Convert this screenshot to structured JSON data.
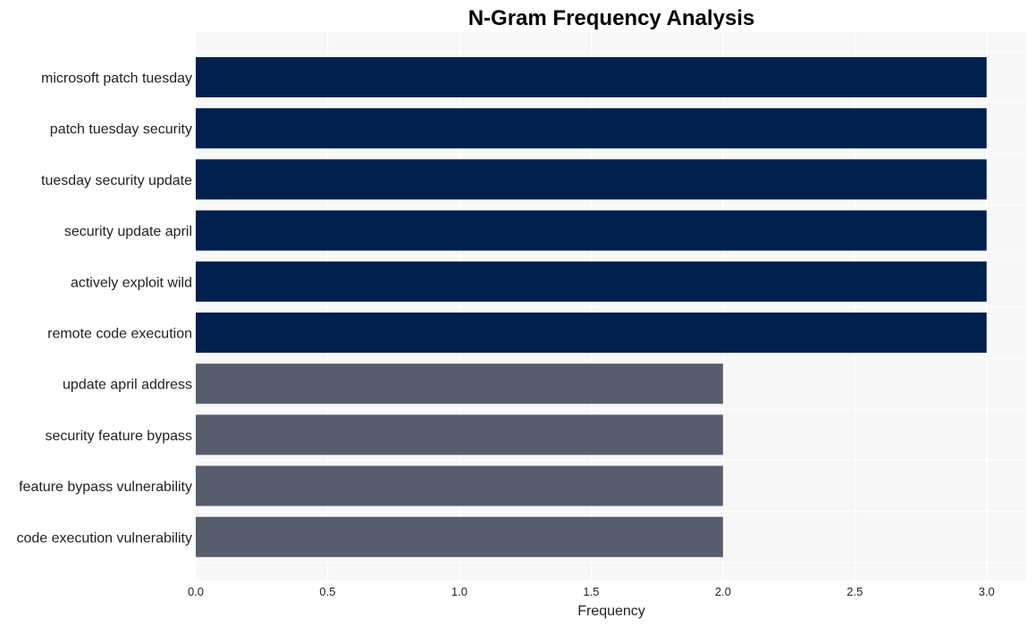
{
  "chart_data": {
    "type": "bar",
    "orientation": "horizontal",
    "title": "N-Gram Frequency Analysis",
    "xlabel": "Frequency",
    "ylabel": "",
    "xlim": [
      0,
      3.15
    ],
    "xticks": [
      0.0,
      0.5,
      1.0,
      1.5,
      2.0,
      2.5,
      3.0
    ],
    "xtick_labels": [
      "0.0",
      "0.5",
      "1.0",
      "1.5",
      "2.0",
      "2.5",
      "3.0"
    ],
    "grid": true,
    "categories": [
      "microsoft patch tuesday",
      "patch tuesday security",
      "tuesday security update",
      "security update april",
      "actively exploit wild",
      "remote code execution",
      "update april address",
      "security feature bypass",
      "feature bypass vulnerability",
      "code execution vulnerability"
    ],
    "values": [
      3,
      3,
      3,
      3,
      3,
      3,
      2,
      2,
      2,
      2
    ],
    "colors": {
      "high": "#00214d",
      "low": "#575d6d",
      "plot_background": "#f7f7f7",
      "grid": "#ffffff"
    }
  }
}
